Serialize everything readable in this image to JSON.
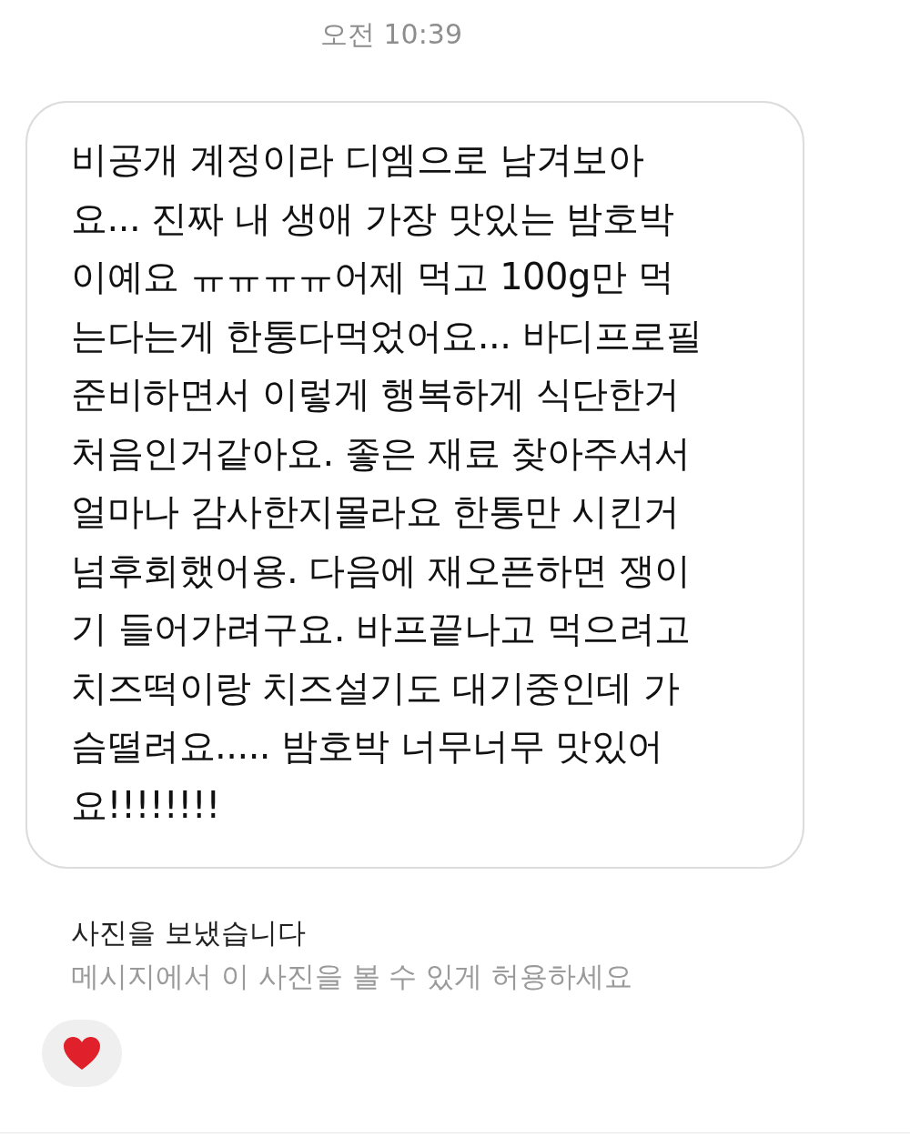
{
  "timestamp": "오전 10:39",
  "message": {
    "lines": [
      "비공개 계정이라 디엠으로 남겨보아",
      "요... 진짜 내 생애 가장 맛있는 밤호박",
      "이예요 ㅠㅠㅠㅠ어제 먹고 100g만 먹",
      "는다는게 한통다먹었어요... 바디프로필",
      "준비하면서 이렇게 행복하게 식단한거",
      "처음인거같아요. 좋은 재료 찾아주셔서",
      "얼마나 감사한지몰라요 한통만 시킨거",
      "넘후회했어용. 다음에 재오픈하면 쟁이",
      "기 들어가려구요. 바프끝나고 먹으려고",
      "치즈떡이랑 치즈설기도 대기중인데 가",
      "슴떨려요..... 밤호박 너무너무 맛있어",
      "요!!!!!!!!"
    ]
  },
  "photo_notice": {
    "title": "사진을 보냈습니다",
    "subtitle": "메시지에서 이 사진을 볼 수 있게 허용하세요"
  },
  "reaction": {
    "kind": "heart"
  }
}
